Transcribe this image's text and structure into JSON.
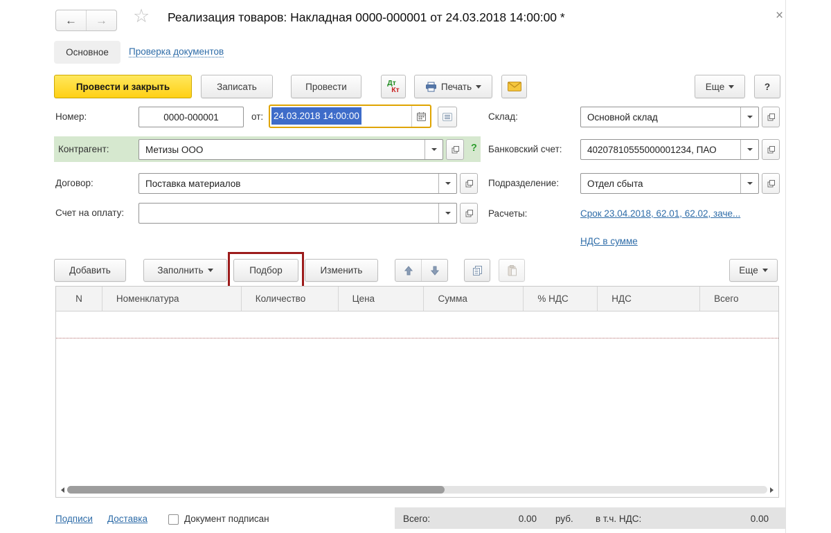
{
  "window": {
    "title": "Реализация товаров: Накладная 0000-000001 от 24.03.2018 14:00:00 *",
    "close_glyph": "×"
  },
  "icons": {
    "back": "←",
    "forward": "→",
    "star": "☆"
  },
  "tabs": {
    "main": "Основное",
    "documents_check": "Проверка документов"
  },
  "toolbar": {
    "post_and_close": "Провести и закрыть",
    "save": "Записать",
    "post": "Провести",
    "dtkt_top": "Дт",
    "dtkt_bottom": "Кт",
    "print": "Печать",
    "more": "Еще",
    "help": "?"
  },
  "form": {
    "number": {
      "label": "Номер:",
      "value": "0000-000001"
    },
    "date": {
      "label": "от:",
      "value": "24.03.2018 14:00:00"
    },
    "counterparty": {
      "label": "Контрагент:",
      "value": "Метизы ООО",
      "help": "?"
    },
    "contract": {
      "label": "Договор:",
      "value": "Поставка материалов"
    },
    "payment_invoice": {
      "label": "Счет на оплату:",
      "value": ""
    },
    "warehouse": {
      "label": "Склад:",
      "value": "Основной склад"
    },
    "bank_account": {
      "label": "Банковский счет:",
      "value": "40207810555000001234, ПАО"
    },
    "department": {
      "label": "Подразделение:",
      "value": "Отдел сбыта"
    },
    "settlements": {
      "label": "Расчеты:",
      "link": "Срок 23.04.2018, 62.01, 62.02, заче...",
      "vat_link": "НДС в сумме"
    }
  },
  "items_toolbar": {
    "add": "Добавить",
    "fill": "Заполнить",
    "pick": "Подбор",
    "edit": "Изменить",
    "more": "Еще"
  },
  "items_table": {
    "columns": [
      "N",
      "Номенклатура",
      "Количество",
      "Цена",
      "Сумма",
      "% НДС",
      "НДС",
      "Всего"
    ]
  },
  "footer": {
    "signatures": "Подписи",
    "delivery": "Доставка",
    "signed_checkbox_label": "Документ подписан",
    "total_label": "Всего:",
    "total_value": "0.00",
    "currency": "руб.",
    "vat_label": "в т.ч. НДС:",
    "vat_value": "0.00"
  },
  "colors": {
    "primary_yellow": "#ffd42b",
    "green_highlight": "#d6e8cf",
    "annotation_red": "#9c1b1b",
    "link_blue": "#2e6ca8",
    "selection_blue": "#3e6cc9"
  }
}
